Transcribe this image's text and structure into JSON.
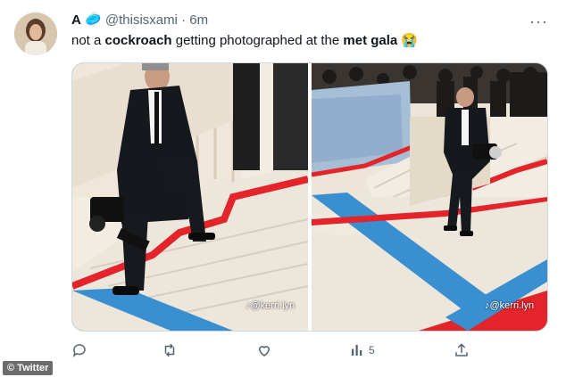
{
  "tweet": {
    "name": "A",
    "handle": "@thisisxami",
    "separator": "·",
    "time": "6m",
    "more": "···",
    "text_parts": [
      "not a ",
      "cockroach",
      " getting photographed at the ",
      "met gala",
      " 😭"
    ]
  },
  "media": {
    "watermark_left": "♪@kerri.lyn",
    "watermark_right": "♪@kerri.lyn"
  },
  "actions": {
    "reply_count": "",
    "retweet_count": "",
    "like_count": "",
    "views_count": "5"
  },
  "badge": "© Twitter",
  "icons": [
    "reply-icon",
    "retweet-icon",
    "like-icon",
    "views-icon",
    "share-icon",
    "more-icon",
    "tiktok-icon"
  ],
  "colors": {
    "red_carpet": "#e3242b",
    "blue_stripe": "#3a8fd0",
    "stairs": "#ede6da",
    "text_muted": "#536471"
  }
}
